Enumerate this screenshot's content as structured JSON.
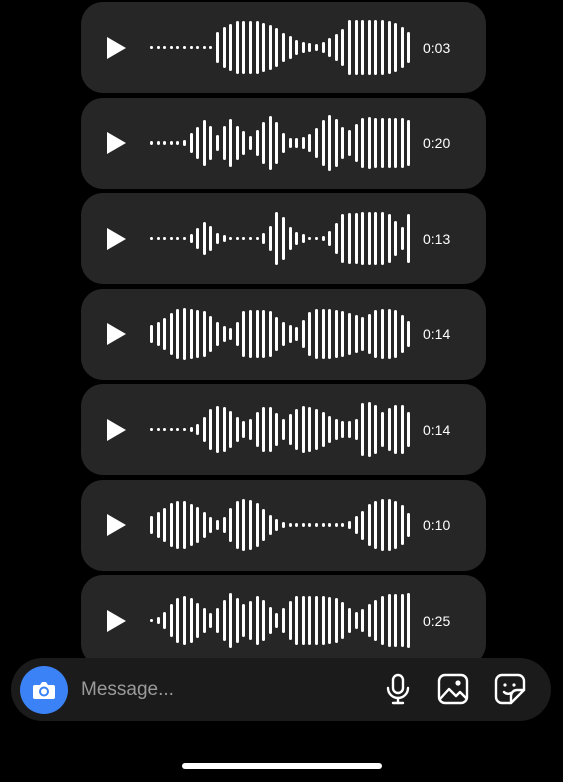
{
  "voice_messages": [
    {
      "duration": "0:03",
      "waveform": [
        0.06,
        0.06,
        0.06,
        0.06,
        0.06,
        0.06,
        0.06,
        0.06,
        0.06,
        0.06,
        0.55,
        0.72,
        0.82,
        0.9,
        0.9,
        0.9,
        0.9,
        0.84,
        0.77,
        0.66,
        0.5,
        0.38,
        0.27,
        0.2,
        0.16,
        0.12,
        0.2,
        0.34,
        0.48,
        0.64,
        0.95,
        0.95,
        0.95,
        0.95,
        0.95,
        0.95,
        0.92,
        0.85,
        0.72,
        0.52
      ]
    },
    {
      "duration": "0:20",
      "waveform": [
        0.06,
        0.06,
        0.06,
        0.06,
        0.06,
        0.12,
        0.34,
        0.55,
        0.78,
        0.6,
        0.28,
        0.58,
        0.82,
        0.6,
        0.42,
        0.24,
        0.46,
        0.72,
        0.92,
        0.72,
        0.36,
        0.16,
        0.16,
        0.2,
        0.3,
        0.52,
        0.8,
        0.95,
        0.82,
        0.56,
        0.44,
        0.66,
        0.86,
        0.88,
        0.86,
        0.86,
        0.86,
        0.86,
        0.86,
        0.8
      ]
    },
    {
      "duration": "0:13",
      "waveform": [
        0.06,
        0.06,
        0.06,
        0.06,
        0.06,
        0.06,
        0.16,
        0.36,
        0.56,
        0.42,
        0.2,
        0.12,
        0.06,
        0.06,
        0.06,
        0.06,
        0.06,
        0.18,
        0.44,
        0.9,
        0.74,
        0.4,
        0.24,
        0.14,
        0.06,
        0.06,
        0.1,
        0.26,
        0.52,
        0.86,
        0.88,
        0.88,
        0.9,
        0.9,
        0.9,
        0.9,
        0.84,
        0.62,
        0.4,
        0.86
      ]
    },
    {
      "duration": "0:14",
      "waveform": [
        0.32,
        0.42,
        0.56,
        0.74,
        0.86,
        0.88,
        0.86,
        0.84,
        0.78,
        0.62,
        0.42,
        0.28,
        0.2,
        0.42,
        0.78,
        0.84,
        0.84,
        0.84,
        0.78,
        0.58,
        0.4,
        0.3,
        0.24,
        0.48,
        0.76,
        0.86,
        0.86,
        0.86,
        0.84,
        0.8,
        0.72,
        0.64,
        0.6,
        0.68,
        0.82,
        0.86,
        0.86,
        0.82,
        0.66,
        0.44
      ]
    },
    {
      "duration": "0:14",
      "waveform": [
        0.06,
        0.06,
        0.06,
        0.06,
        0.06,
        0.06,
        0.1,
        0.2,
        0.44,
        0.72,
        0.8,
        0.78,
        0.64,
        0.44,
        0.28,
        0.36,
        0.62,
        0.78,
        0.76,
        0.58,
        0.36,
        0.52,
        0.72,
        0.8,
        0.78,
        0.72,
        0.62,
        0.46,
        0.36,
        0.3,
        0.3,
        0.36,
        0.9,
        0.94,
        0.84,
        0.62,
        0.74,
        0.86,
        0.84,
        0.6
      ]
    },
    {
      "duration": "0:10",
      "waveform": [
        0.3,
        0.44,
        0.6,
        0.76,
        0.84,
        0.82,
        0.74,
        0.62,
        0.44,
        0.26,
        0.16,
        0.26,
        0.58,
        0.82,
        0.88,
        0.86,
        0.76,
        0.56,
        0.36,
        0.2,
        0.12,
        0.06,
        0.06,
        0.06,
        0.06,
        0.06,
        0.06,
        0.06,
        0.06,
        0.06,
        0.14,
        0.32,
        0.5,
        0.72,
        0.84,
        0.9,
        0.9,
        0.84,
        0.68,
        0.42
      ]
    },
    {
      "duration": "0:25",
      "waveform": [
        0.06,
        0.12,
        0.3,
        0.56,
        0.76,
        0.86,
        0.76,
        0.6,
        0.44,
        0.26,
        0.42,
        0.72,
        0.94,
        0.76,
        0.56,
        0.68,
        0.84,
        0.72,
        0.46,
        0.26,
        0.42,
        0.66,
        0.84,
        0.86,
        0.86,
        0.86,
        0.84,
        0.82,
        0.76,
        0.64,
        0.44,
        0.3,
        0.4,
        0.58,
        0.72,
        0.84,
        0.9,
        0.9,
        0.9,
        0.94
      ]
    }
  ],
  "composer": {
    "placeholder": "Message..."
  },
  "icons": {
    "camera": "camera-icon",
    "microphone": "microphone-icon",
    "gallery": "image-icon",
    "sticker": "sticker-icon"
  },
  "colors": {
    "accent": "#3b82f6",
    "bubble": "#262626",
    "background": "#000000"
  }
}
